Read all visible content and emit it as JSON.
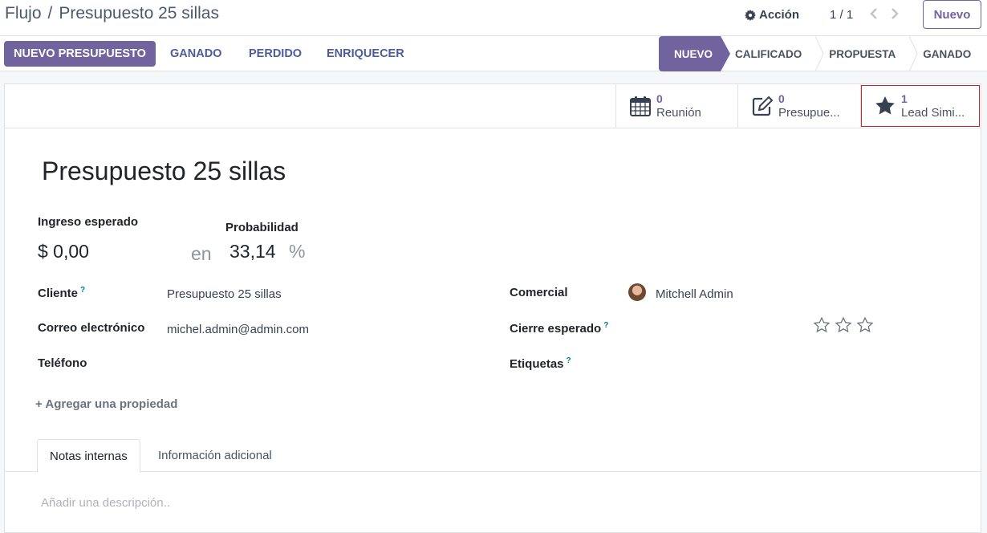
{
  "breadcrumb": {
    "parent": "Flujo",
    "separator": "/",
    "current": "Presupuesto 25 sillas"
  },
  "header": {
    "action_label": "Acción",
    "pager": "1 / 1",
    "new_button": "Nuevo"
  },
  "statusbar": {
    "buttons": [
      "NUEVO PRESUPUESTO",
      "GANADO",
      "PERDIDO",
      "ENRIQUECER"
    ],
    "stages": [
      "NUEVO",
      "CALIFICADO",
      "PROPUESTA",
      "GANADO"
    ],
    "active_stage": "NUEVO"
  },
  "smart_buttons": [
    {
      "icon": "calendar-icon",
      "value": "0",
      "label": "Reunión"
    },
    {
      "icon": "edit-icon",
      "value": "0",
      "label": "Presupue..."
    },
    {
      "icon": "star-icon",
      "value": "1",
      "label": "Lead Simi..."
    }
  ],
  "record": {
    "title": "Presupuesto 25 sillas",
    "expected_revenue_label": "Ingreso esperado",
    "expected_revenue": "$ 0,00",
    "at_label": "en",
    "probability_label": "Probabilidad",
    "probability": "33,14",
    "percent": "%"
  },
  "fields": {
    "cliente_label": "Cliente",
    "cliente_value": "Presupuesto 25 sillas",
    "email_label": "Correo electrónico",
    "email_value": "michel.admin@admin.com",
    "phone_label": "Teléfono",
    "phone_value": "",
    "comercial_label": "Comercial",
    "comercial_value": "Mitchell Admin",
    "cierre_label": "Cierre esperado",
    "priority_stars": 0,
    "priority_max": 3,
    "etiquetas_label": "Etiquetas",
    "help_mark": "?"
  },
  "add_property": "+ Agregar una propiedad",
  "tabs": [
    "Notas internas",
    "Información adicional"
  ],
  "description_placeholder": "Añadir una descripción..",
  "colors": {
    "brand": "#71639e",
    "highlight": "#d0212a"
  }
}
